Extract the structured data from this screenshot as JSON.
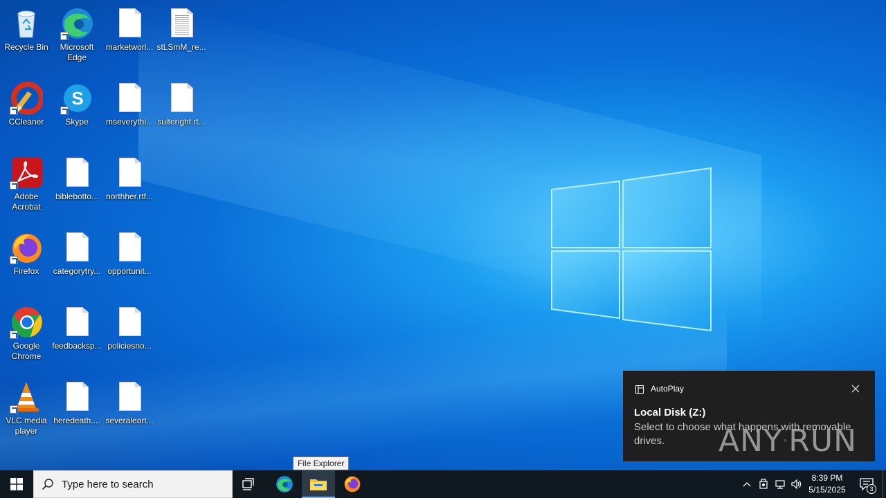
{
  "desktop": {
    "icons": [
      {
        "label": "Recycle Bin",
        "icon": "recycle-bin-icon"
      },
      {
        "label": "Microsoft Edge",
        "icon": "edge-icon"
      },
      {
        "label": "marketworl...",
        "icon": "document-icon"
      },
      {
        "label": "stLSmM_re...",
        "icon": "text-document-icon"
      },
      {
        "label": "CCleaner",
        "icon": "ccleaner-icon"
      },
      {
        "label": "Skype",
        "icon": "skype-icon"
      },
      {
        "label": "mseverythi...",
        "icon": "document-icon"
      },
      {
        "label": "suiteright.rt...",
        "icon": "document-icon"
      },
      {
        "label": "Adobe Acrobat",
        "icon": "acrobat-icon"
      },
      {
        "label": "biblebotto...",
        "icon": "document-icon"
      },
      {
        "label": "northher.rtf...",
        "icon": "document-icon"
      },
      {
        "label": "Firefox",
        "icon": "firefox-icon"
      },
      {
        "label": "categorytry...",
        "icon": "document-icon"
      },
      {
        "label": "opportunit...",
        "icon": "document-icon"
      },
      {
        "label": "Google Chrome",
        "icon": "chrome-icon"
      },
      {
        "label": "feedbacksp...",
        "icon": "document-icon"
      },
      {
        "label": "policiesno...",
        "icon": "document-icon"
      },
      {
        "label": "VLC media player",
        "icon": "vlc-icon"
      },
      {
        "label": "heredeath....",
        "icon": "document-icon"
      },
      {
        "label": "severaleart...",
        "icon": "document-icon"
      }
    ]
  },
  "tooltip": {
    "text": "File Explorer"
  },
  "toast": {
    "app_name": "AutoPlay",
    "title": "Local Disk (Z:)",
    "body": "Select to choose what happens with removable drives.",
    "watermark_left": "ANY",
    "watermark_right": "RUN"
  },
  "taskbar": {
    "search_placeholder": "Type here to search",
    "pinned": [
      "task-view-icon",
      "edge-icon",
      "file-explorer-icon",
      "firefox-icon"
    ],
    "clock_time": "8:39 PM",
    "clock_date": "5/15/2025",
    "notification_count": "3"
  },
  "colors": {
    "taskbar": "#101820",
    "toast_bg": "#1f1f1f",
    "accent": "#0a6fd8"
  }
}
